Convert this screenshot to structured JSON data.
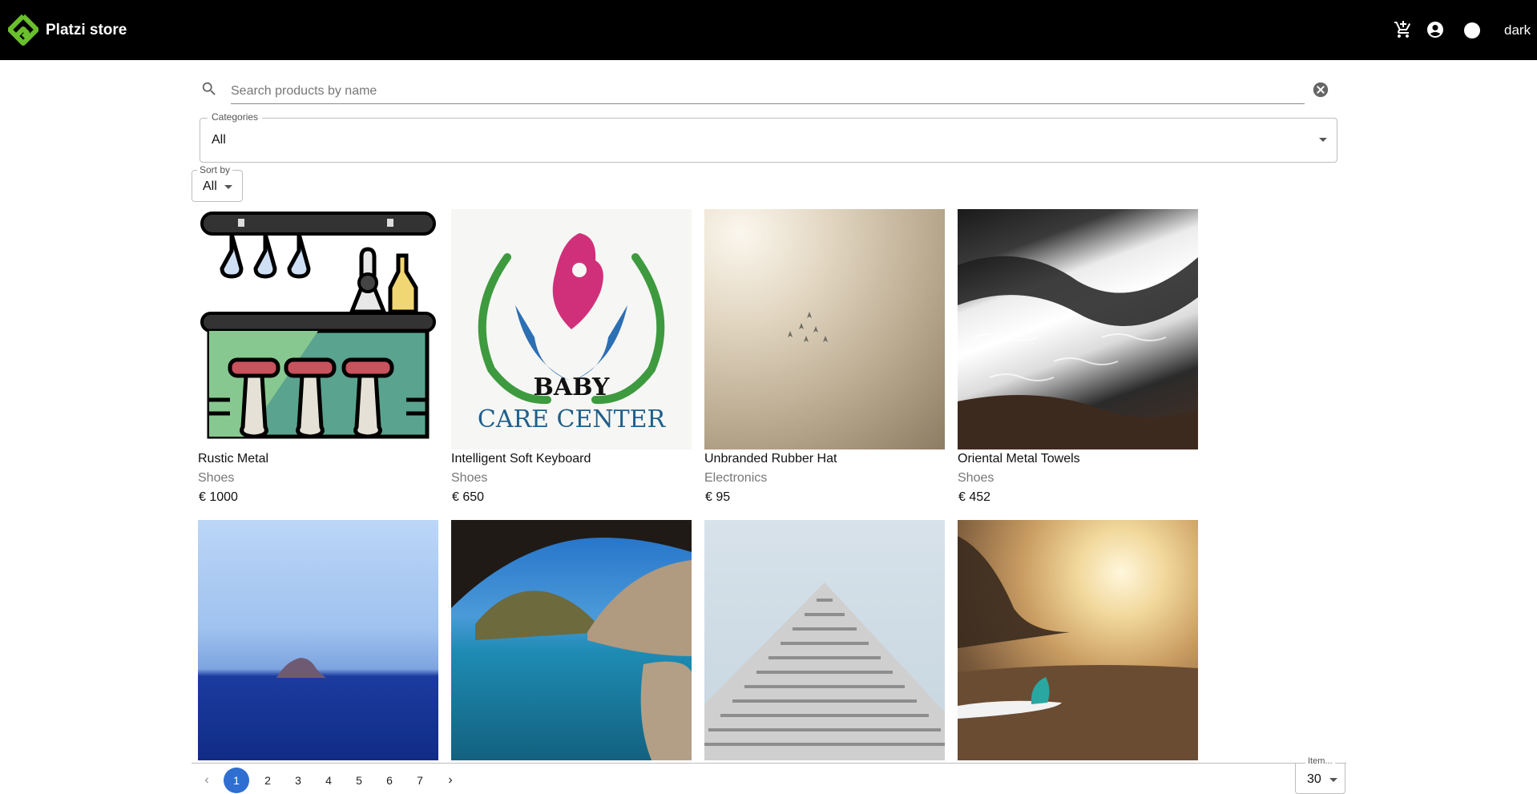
{
  "header": {
    "brand": "Platzi store",
    "theme_label": "dark",
    "logo_color": "#6abf2c"
  },
  "search": {
    "placeholder": "Search products by name",
    "value": ""
  },
  "categories": {
    "label": "Categories",
    "selected": "All"
  },
  "sort": {
    "label": "Sort by",
    "selected": "All"
  },
  "products": [
    {
      "name": "Rustic Metal",
      "category": "Shoes",
      "price": "€ 1000",
      "image": "bar-counter-illustration"
    },
    {
      "name": "Intelligent Soft Keyboard",
      "category": "Shoes",
      "price": "€ 650",
      "image": "baby-care-center-logo"
    },
    {
      "name": "Unbranded Rubber Hat",
      "category": "Electronics",
      "price": "€ 95",
      "image": "jets-in-hazy-sky"
    },
    {
      "name": "Oriental Metal Towels",
      "category": "Shoes",
      "price": "€ 452",
      "image": "ocean-waves-rocks"
    },
    {
      "image": "island-blue-sea"
    },
    {
      "image": "sea-cave-cliffs"
    },
    {
      "image": "white-building-perspective"
    },
    {
      "image": "surfboard-beach-sunset"
    }
  ],
  "pagination": {
    "pages": [
      "1",
      "2",
      "3",
      "4",
      "5",
      "6",
      "7"
    ],
    "current": "1",
    "active_color": "#2f6fd1"
  },
  "items_per_page": {
    "label": "Item...",
    "value": "30"
  },
  "baby_logo": {
    "line1": "BABY",
    "line2": "CARE CENTER"
  }
}
